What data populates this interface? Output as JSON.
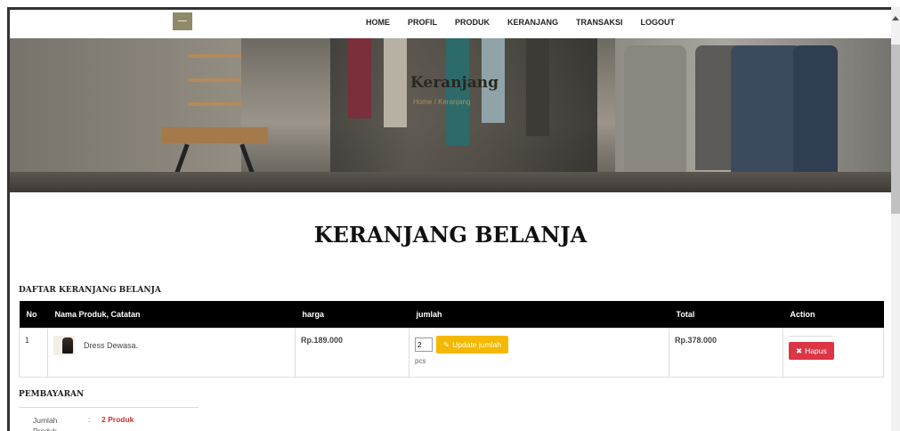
{
  "nav": {
    "items": [
      "HOME",
      "PROFIL",
      "PRODUK",
      "KERANJANG",
      "TRANSAKSI",
      "LOGOUT"
    ]
  },
  "banner": {
    "title": "Keranjang",
    "breadcrumb": "Home / Keranjang"
  },
  "page": {
    "title": "KERANJANG BELANJA",
    "section_title": "DAFTAR KERANJANG BELANJA"
  },
  "table": {
    "headers": [
      "No",
      "Nama Produk, Catatan",
      "harga",
      "jumlah",
      "Total",
      "Action"
    ],
    "rows": [
      {
        "no": "1",
        "product": "Dress Dewasa.",
        "harga": "Rp.189.000",
        "qty": "2",
        "update_label": "Update jumlah",
        "unit": "pcs",
        "total": "Rp.378.000",
        "delete_label": "Hapus"
      }
    ]
  },
  "payment": {
    "title": "PEMBAYARAN",
    "label": "Jumlah Produk",
    "colon": ":",
    "value": "2 Produk"
  },
  "colors": {
    "update_button": "#f5b800",
    "delete_button": "#dc3545",
    "price": "#2e7d32",
    "table_header": "#000000"
  }
}
